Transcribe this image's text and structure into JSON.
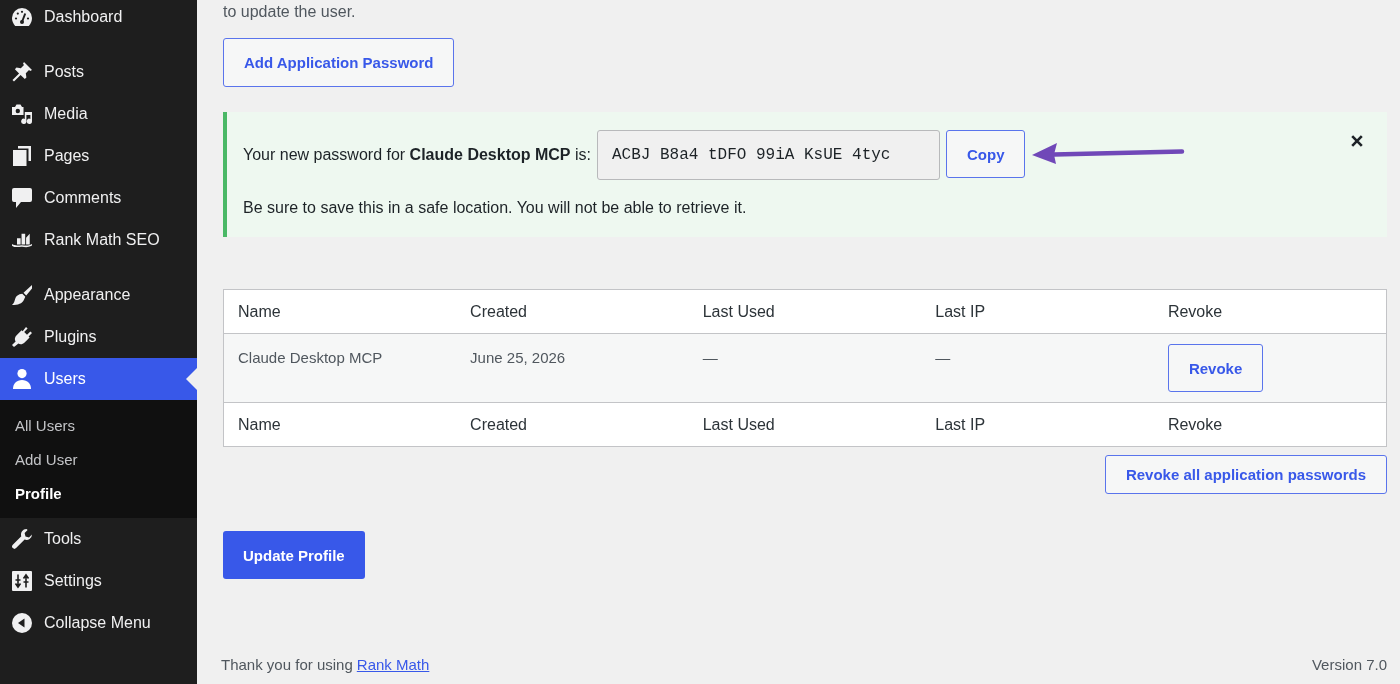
{
  "sidebar": {
    "groups": [
      [
        {
          "label": "Dashboard",
          "selected": false
        }
      ],
      [
        {
          "label": "Posts",
          "selected": false
        },
        {
          "label": "Media",
          "selected": false
        },
        {
          "label": "Pages",
          "selected": false
        },
        {
          "label": "Comments",
          "selected": false
        },
        {
          "label": "Rank Math SEO",
          "selected": false
        }
      ],
      [
        {
          "label": "Appearance",
          "selected": false
        },
        {
          "label": "Plugins",
          "selected": false
        },
        {
          "label": "Users",
          "selected": true,
          "children": [
            {
              "label": "All Users",
              "selected": false
            },
            {
              "label": "Add User",
              "selected": false
            },
            {
              "label": "Profile",
              "selected": true
            }
          ]
        },
        {
          "label": "Tools",
          "selected": false
        },
        {
          "label": "Settings",
          "selected": false
        }
      ]
    ],
    "collapse": "Collapse Menu"
  },
  "application_passwords": {
    "intro": "to update the user.",
    "add_button": "Add Application Password",
    "notice": {
      "kind": "success",
      "message": "Your new password for **Claude Desktop MCP** is:",
      "password": "ACBJ B8a4 tDFO 99iA KsUE 4tyc",
      "copy_button": "Copy",
      "note": "Be sure to save this in a safe location. You will not be able to retrieve it."
    },
    "table": {
      "columns": [
        "Name",
        "Created",
        "Last Used",
        "Last IP",
        "Revoke"
      ],
      "rows": [
        {
          "cells": [
            "Claude Desktop MCP",
            "June 25, 2026",
            "—",
            "—"
          ],
          "button": "Revoke"
        }
      ],
      "footer": [
        "Name",
        "Created",
        "Last Used",
        "Last IP",
        "Revoke"
      ]
    },
    "revoke_all_button": "Revoke all application passwords"
  },
  "submit_button": "Update Profile",
  "footer": {
    "thanks": "Thank you for using",
    "link": "Rank Math",
    "version": "Version 7.0"
  }
}
